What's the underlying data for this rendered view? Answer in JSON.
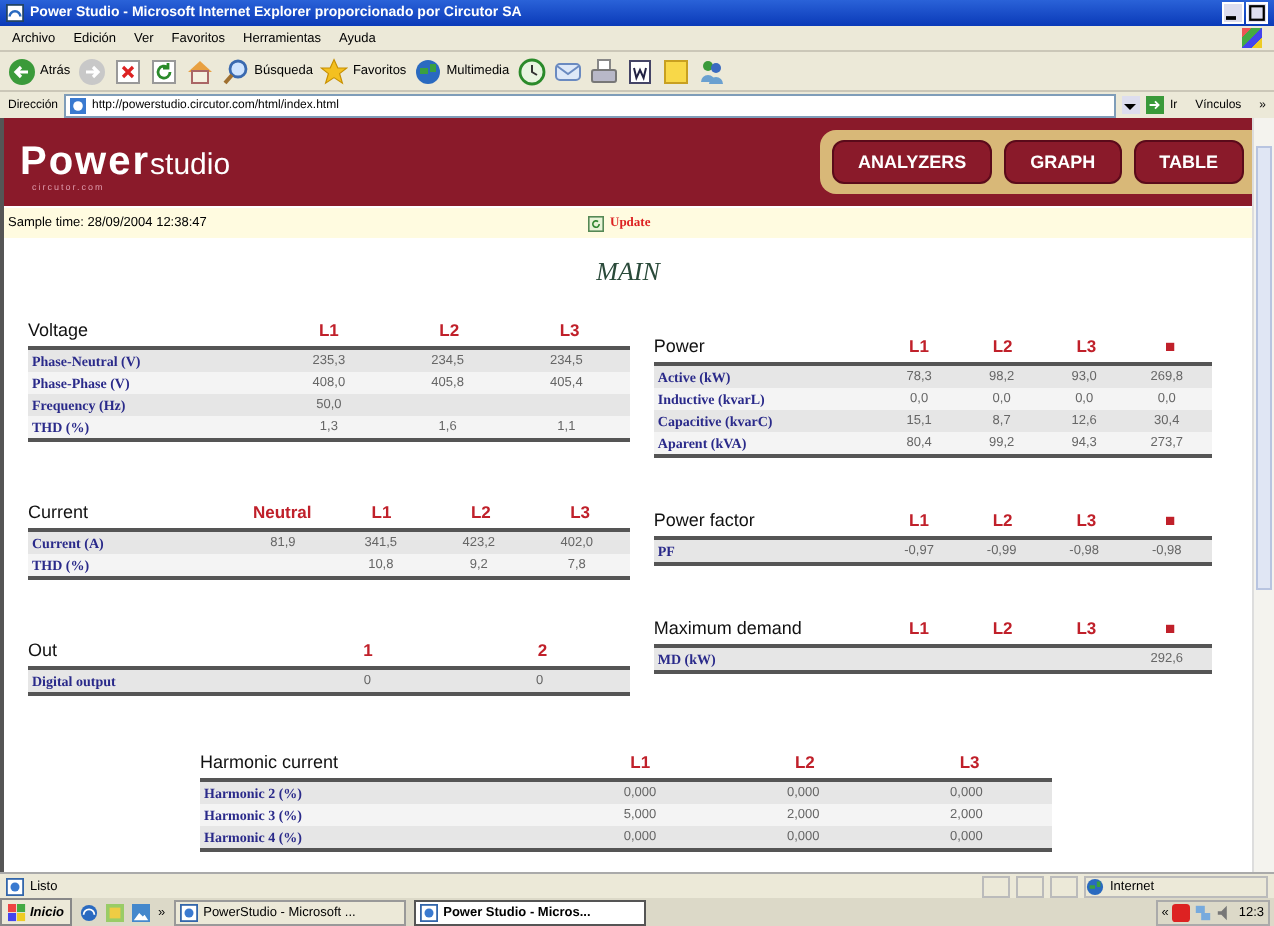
{
  "browser": {
    "title": "Power Studio - Microsoft Internet Explorer proporcionado por Circutor SA",
    "menu": [
      "Archivo",
      "Edición",
      "Ver",
      "Favoritos",
      "Herramientas",
      "Ayuda"
    ],
    "toolbar": [
      {
        "kind": "back",
        "label": "Atrás"
      },
      {
        "kind": "forward"
      },
      {
        "kind": "stop"
      },
      {
        "kind": "refresh"
      },
      {
        "kind": "home"
      },
      {
        "kind": "search",
        "label": "Búsqueda"
      },
      {
        "kind": "favorites",
        "label": "Favoritos"
      },
      {
        "kind": "media",
        "label": "Multimedia"
      },
      {
        "kind": "history"
      },
      {
        "kind": "mail"
      },
      {
        "kind": "print"
      },
      {
        "kind": "word"
      },
      {
        "kind": "folder"
      },
      {
        "kind": "messenger"
      }
    ],
    "address_label": "Dirección",
    "url": "http://powerstudio.circutor.com/html/index.html",
    "go": "Ir",
    "links": "Vínculos",
    "links_more": "»"
  },
  "app": {
    "logo": "Power",
    "logo_sub": "circutor.com",
    "logo_suffix": "studio",
    "nav": [
      "ANALYZERS",
      "GRAPH",
      "TABLE"
    ],
    "sample_time": "Sample time: 28/09/2004 12:38:47",
    "update": "Update",
    "page_title": "MAIN"
  },
  "left_tables": [
    {
      "title": "Voltage",
      "columns": [
        "L1",
        "L2",
        "L3"
      ],
      "rows": [
        {
          "label": "Phase-Neutral (V)",
          "cells": [
            "235,3",
            "234,5",
            "234,5"
          ]
        },
        {
          "label": "Phase-Phase (V)",
          "cells": [
            "408,0",
            "405,8",
            "405,4"
          ]
        },
        {
          "label": "Frequency (Hz)",
          "cells": [
            "50,0",
            null,
            null
          ]
        },
        {
          "label": "THD (%)",
          "cells": [
            "1,3",
            "1,6",
            "1,1"
          ]
        }
      ]
    },
    {
      "title": "Current",
      "columns": [
        "Neutral",
        "L1",
        "L2",
        "L3"
      ],
      "rows": [
        {
          "label": "Current (A)",
          "cells": [
            "81,9",
            "341,5",
            "423,2",
            "402,0"
          ]
        },
        {
          "label": "THD (%)",
          "cells": [
            null,
            "10,8",
            "9,2",
            "7,8"
          ]
        }
      ]
    },
    {
      "title": "Out",
      "columns": [
        "1",
        "2"
      ],
      "rows": [
        {
          "label": "Digital output",
          "cells": [
            "0",
            "0"
          ]
        }
      ]
    }
  ],
  "right_tables": [
    {
      "title": "Power",
      "columns": [
        "L1",
        "L2",
        "L3",
        "■"
      ],
      "rows": [
        {
          "label": "Active (kW)",
          "cells": [
            "78,3",
            "98,2",
            "93,0",
            "269,8"
          ]
        },
        {
          "label": "Inductive (kvarL)",
          "cells": [
            "0,0",
            "0,0",
            "0,0",
            "0,0"
          ]
        },
        {
          "label": "Capacitive (kvarC)",
          "cells": [
            "15,1",
            "8,7",
            "12,6",
            "30,4"
          ]
        },
        {
          "label": "Aparent (kVA)",
          "cells": [
            "80,4",
            "99,2",
            "94,3",
            "273,7"
          ]
        }
      ]
    },
    {
      "title": "Power factor",
      "columns": [
        "L1",
        "L2",
        "L3",
        "■"
      ],
      "rows": [
        {
          "label": "PF",
          "cells": [
            "-0,97",
            "-0,99",
            "-0,98",
            "-0,98"
          ]
        }
      ]
    },
    {
      "title": "Maximum demand",
      "columns": [
        "L1",
        "L2",
        "L3",
        "■"
      ],
      "rows": [
        {
          "label": "MD (kW)",
          "cells": [
            null,
            null,
            null,
            "292,6"
          ]
        }
      ]
    }
  ],
  "harmonic_table": {
    "title": "Harmonic current",
    "columns": [
      "L1",
      "L2",
      "L3"
    ],
    "rows": [
      {
        "label": "Harmonic 2 (%)",
        "cells": [
          "0,000",
          "0,000",
          "0,000"
        ]
      },
      {
        "label": "Harmonic 3 (%)",
        "cells": [
          "5,000",
          "2,000",
          "2,000"
        ]
      },
      {
        "label": "Harmonic 4 (%)",
        "cells": [
          "0,000",
          "0,000",
          "0,000"
        ]
      }
    ]
  },
  "status_bar": {
    "text": "Listo",
    "zone": "Internet"
  },
  "taskbar": {
    "start": "Inicio",
    "more": "»",
    "tasks": [
      {
        "label": "PowerStudio - Microsoft ...",
        "selected": false
      },
      {
        "label": "Power Studio - Micros...",
        "selected": true
      }
    ],
    "tray_more": "«",
    "clock": "12:3"
  }
}
